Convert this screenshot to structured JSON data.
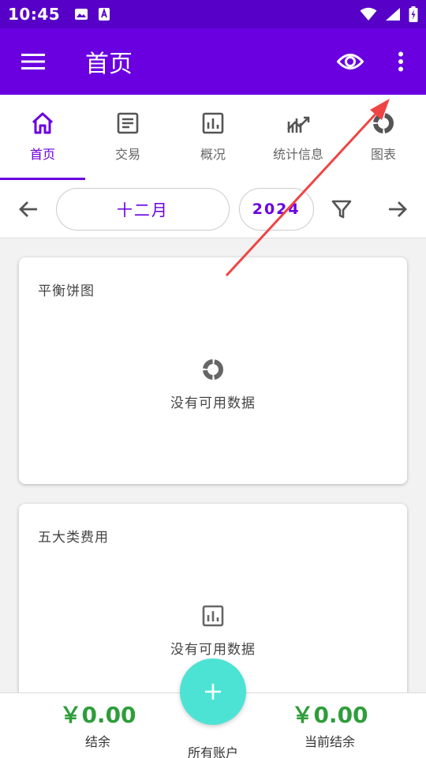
{
  "status_bar": {
    "time": "10:45"
  },
  "app_bar": {
    "title": "首页"
  },
  "tabs": [
    {
      "label": "首页",
      "icon": "home-icon",
      "active": true
    },
    {
      "label": "交易",
      "icon": "document-icon"
    },
    {
      "label": "概况",
      "icon": "bar-chart-icon"
    },
    {
      "label": "统计信息",
      "icon": "trend-icon"
    },
    {
      "label": "图表",
      "icon": "donut-icon"
    }
  ],
  "date_bar": {
    "month": "十二月",
    "year": "2024"
  },
  "cards": [
    {
      "title": "平衡饼图",
      "empty_text": "没有可用数据",
      "icon": "donut-icon"
    },
    {
      "title": "五大类费用",
      "empty_text": "没有可用数据",
      "icon": "bar-chart-icon"
    }
  ],
  "bottom_bar": {
    "left_value": "￥0.00",
    "left_label": "结余",
    "right_value": "￥0.00",
    "right_label": "当前结余",
    "center_label": "所有账户"
  },
  "colors": {
    "primary": "#6a00e0",
    "status_bar": "#5600c8",
    "fab": "#4de3d4",
    "balance_green": "#2e9d3a",
    "annotation_arrow": "#ef4444"
  }
}
